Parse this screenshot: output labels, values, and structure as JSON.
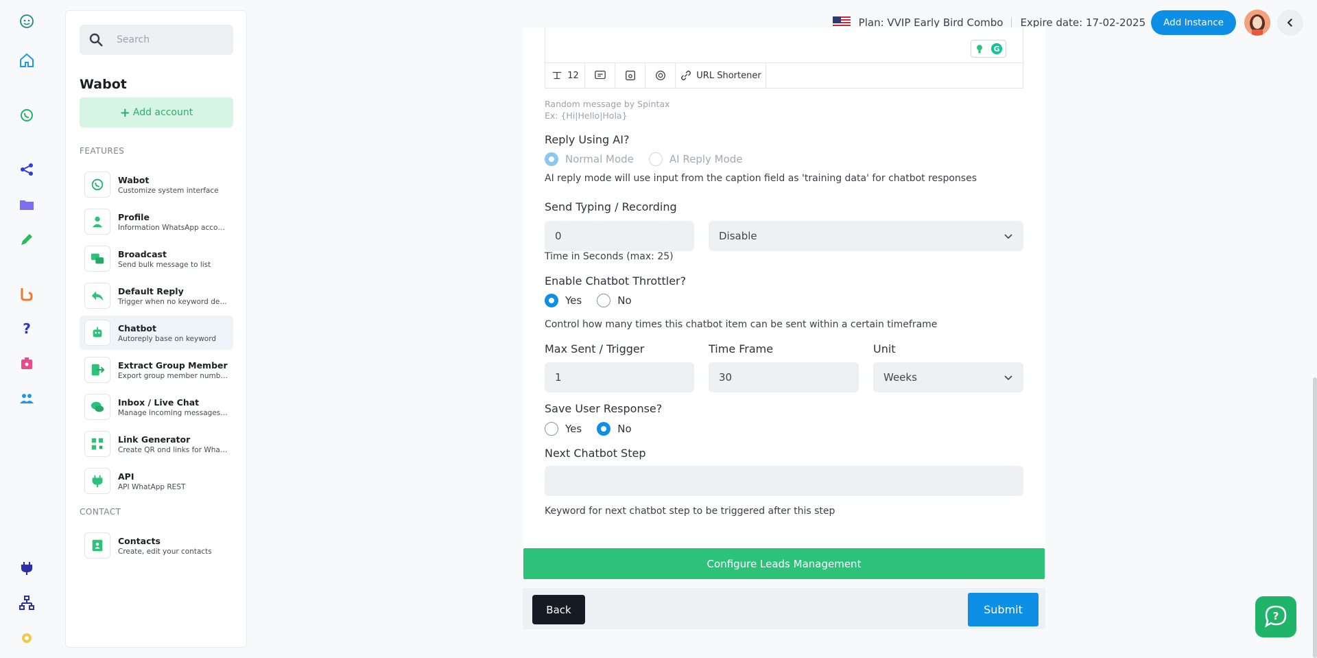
{
  "topbar": {
    "plan": "Plan: VVIP Early Bird Combo",
    "expire": "Expire date: 17-02-2025",
    "add_instance": "Add Instance"
  },
  "sidebar": {
    "search_placeholder": "Search",
    "title": "Wabot",
    "add_account": "Add account",
    "features_label": "FEATURES",
    "contact_label": "CONTACT",
    "items": [
      {
        "title": "Wabot",
        "sub": "Customize system interface"
      },
      {
        "title": "Profile",
        "sub": "Information WhatsApp account"
      },
      {
        "title": "Broadcast",
        "sub": "Send bulk message to list"
      },
      {
        "title": "Default Reply",
        "sub": "Trigger when no keyword dete..."
      },
      {
        "title": "Chatbot",
        "sub": "Autoreply base on keyword"
      },
      {
        "title": "Extract Group Member",
        "sub": "Export group member number"
      },
      {
        "title": "Inbox / Live Chat",
        "sub": "Manage incoming messages ..."
      },
      {
        "title": "Link Generator",
        "sub": "Create QR ond links for Whats..."
      },
      {
        "title": "API",
        "sub": "API WhatApp REST"
      }
    ],
    "contacts": {
      "title": "Contacts",
      "sub": "Create, edit your contacts"
    }
  },
  "form": {
    "toolbar": {
      "count": "12",
      "url_shortener": "URL Shortener"
    },
    "spintax_hint": "Random message by Spintax",
    "spintax_example": "Ex: {Hi|Hello|Hola}",
    "reply_ai_label": "Reply Using AI?",
    "normal_mode": "Normal Mode",
    "ai_reply_mode": "AI Reply Mode",
    "ai_help": "AI reply mode will use input from the caption field as 'training data' for chatbot responses",
    "typing_label": "Send Typing / Recording",
    "typing_value": "0",
    "typing_select": "Disable",
    "typing_help": "Time in Seconds (max: 25)",
    "throttler_label": "Enable Chatbot Throttler?",
    "yes": "Yes",
    "no": "No",
    "throttler_help": "Control how many times this chatbot item can be sent within a certain timeframe",
    "max_sent_label": "Max Sent / Trigger",
    "max_sent_value": "1",
    "time_frame_label": "Time Frame",
    "time_frame_value": "30",
    "unit_label": "Unit",
    "unit_value": "Weeks",
    "save_response_label": "Save User Response?",
    "next_step_label": "Next Chatbot Step",
    "next_step_value": "",
    "next_step_help": "Keyword for next chatbot step to be triggered after this step",
    "configure_leads": "Configure Leads Management",
    "back": "Back",
    "submit": "Submit"
  },
  "colors": {
    "primary": "#0d8fe6",
    "success": "#2cc27a",
    "dark": "#161a23"
  }
}
